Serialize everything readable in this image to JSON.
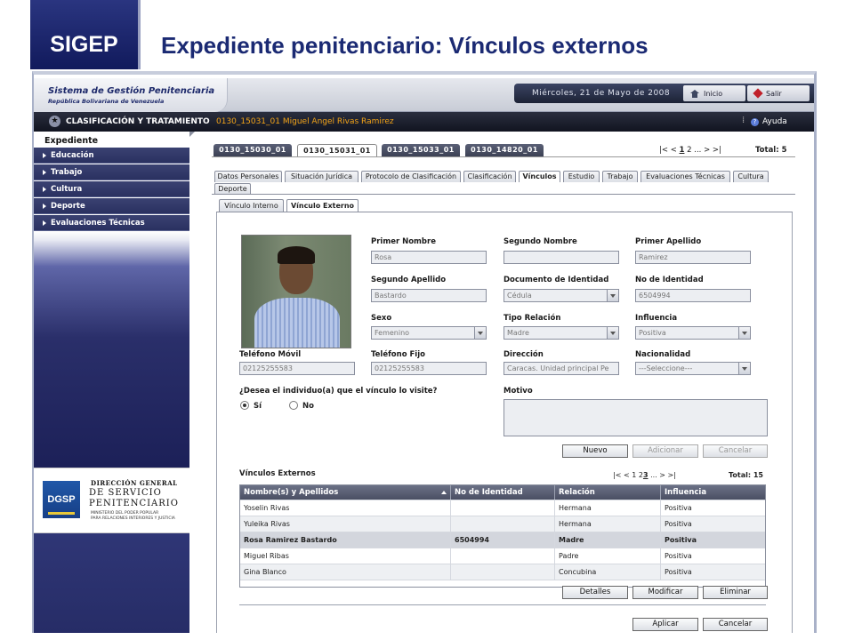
{
  "slide": {
    "logo": "SIGEP",
    "title": "Expediente penitenciario: Vínculos externos"
  },
  "header": {
    "brand_title": "Sistema de Gestión Penitenciaria",
    "brand_subtitle": "República Bolivariana de Venezuela",
    "date": "Miércoles, 21 de Mayo de 2008",
    "inicio": "Inicio",
    "salir": "Salir"
  },
  "nav": {
    "section": "CLASIFICACIÓN Y TRATAMIENTO",
    "record": "0130_15031_01 Miguel Angel Rivas Ramirez",
    "help": "Ayuda"
  },
  "sidebar": {
    "heading": "Expediente",
    "items": [
      "Educación",
      "Trabajo",
      "Cultura",
      "Deporte",
      "Evaluaciones Técnicas"
    ],
    "org": {
      "logo": "DGSP",
      "line1": "DIRECCIÓN GENERAL",
      "line2": "DE SERVICIO",
      "line3": "PENITENCIARIO",
      "line4": "MINISTERIO DEL PODER POPULAR",
      "line5": "PARA RELACIONES INTERIORES Y JUSTICIA"
    }
  },
  "record_tabs": [
    "0130_15030_01",
    "0130_15031_01",
    "0130_15033_01",
    "0130_14820_01"
  ],
  "record_pager": {
    "nav_left": "|<  <",
    "page1": "1",
    "page2": "2",
    "ellipsis": "...",
    "nav_right": ">  >|",
    "total": "Total: 5"
  },
  "section_tabs": [
    "Datos Personales",
    "Situación Jurídica",
    "Protocolo de Clasificación",
    "Clasificación",
    "Vínculos",
    "Estudio",
    "Trabajo",
    "Evaluaciones Técnicas",
    "Cultura",
    "Deporte"
  ],
  "sub_tabs": [
    "Vínculo Interno",
    "Vínculo Externo"
  ],
  "form": {
    "primer_nombre": {
      "label": "Primer Nombre",
      "value": "Rosa"
    },
    "segundo_nombre": {
      "label": "Segundo Nombre",
      "value": ""
    },
    "primer_apellido": {
      "label": "Primer Apellido",
      "value": "Ramirez"
    },
    "segundo_apellido": {
      "label": "Segundo Apellido",
      "value": "Bastardo"
    },
    "documento": {
      "label": "Documento de Identidad",
      "value": "Cédula"
    },
    "no_identidad": {
      "label": "No de Identidad",
      "value": "6504994"
    },
    "sexo": {
      "label": "Sexo",
      "value": "Femenino"
    },
    "tipo_relacion": {
      "label": "Tipo Relación",
      "value": "Madre"
    },
    "influencia": {
      "label": "Influencia",
      "value": "Positiva"
    },
    "telefono_movil": {
      "label": "Teléfono Móvil",
      "value": "02125255583"
    },
    "telefono_fijo": {
      "label": "Teléfono Fijo",
      "value": "02125255583"
    },
    "direccion": {
      "label": "Dirección",
      "value": "Caracas. Unidad principal Pe"
    },
    "nacionalidad": {
      "label": "Nacionalidad",
      "value": "---Seleccione---"
    },
    "visita_question": "¿Desea el individuo(a) que el vínculo lo visite?",
    "si": "Sí",
    "no": "No",
    "motivo": {
      "label": "Motivo",
      "value": ""
    }
  },
  "form_buttons": {
    "nuevo": "Nuevo",
    "adicionar": "Adicionar",
    "cancelar": "Cancelar"
  },
  "vinculos": {
    "title": "Vínculos Externos",
    "pager": {
      "nav_left": "|<  <",
      "pages": "1 2",
      "current": "3",
      "ellipsis": "...",
      "nav_right": ">  >|",
      "total": "Total: 15"
    },
    "columns": [
      "Nombre(s) y Apellidos",
      "No de Identidad",
      "Relación",
      "Influencia"
    ],
    "rows": [
      [
        "Yoselin Rivas",
        "",
        "Hermana",
        "Positiva"
      ],
      [
        "Yuleika Rivas",
        "",
        "Hermana",
        "Positiva"
      ],
      [
        "Rosa Ramirez Bastardo",
        "6504994",
        "Madre",
        "Positiva"
      ],
      [
        "Miguel Ribas",
        "",
        "Padre",
        "Positiva"
      ],
      [
        "Gina Blanco",
        "",
        "Concubina",
        "Positiva"
      ]
    ]
  },
  "grid_buttons": {
    "detalles": "Detalles",
    "modificar": "Modificar",
    "eliminar": "Eliminar"
  },
  "final_buttons": {
    "aplicar": "Aplicar",
    "cancelar": "Cancelar"
  }
}
